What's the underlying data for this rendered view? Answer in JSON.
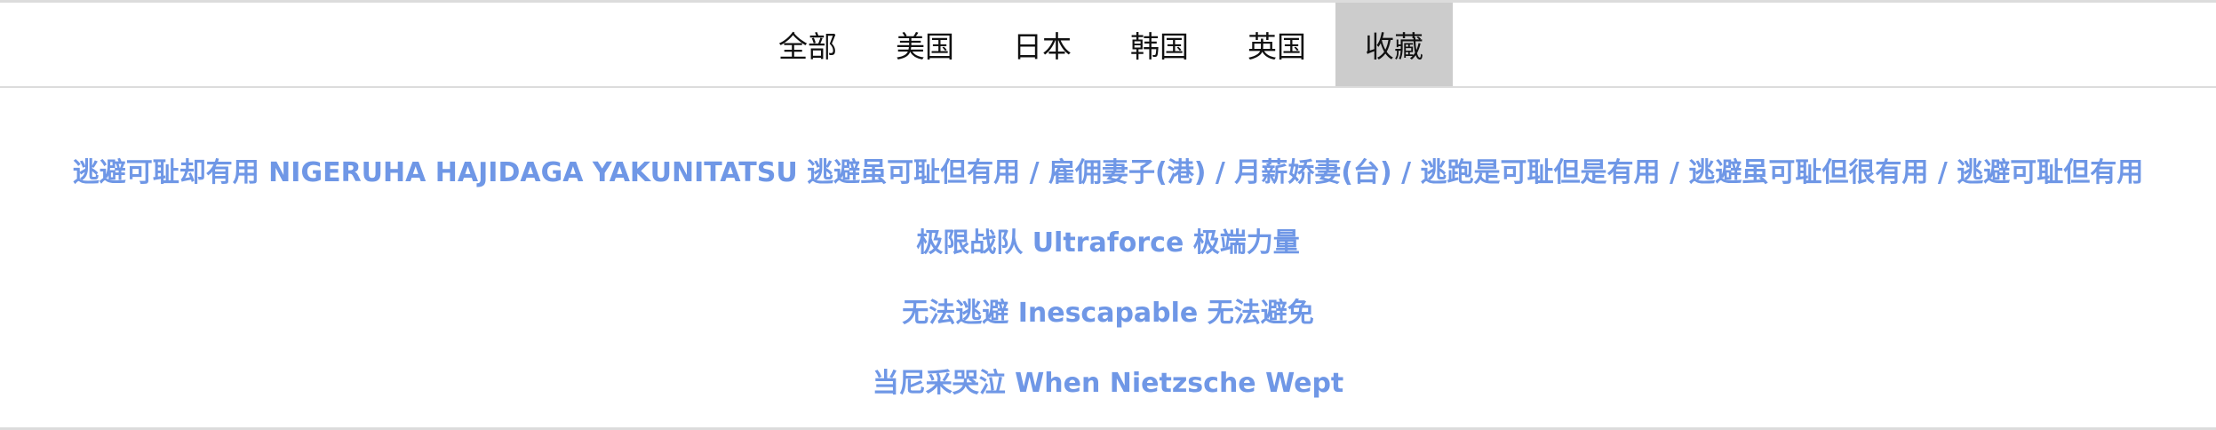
{
  "tabs": [
    {
      "label": "全部",
      "active": false
    },
    {
      "label": "美国",
      "active": false
    },
    {
      "label": "日本",
      "active": false
    },
    {
      "label": "韩国",
      "active": false
    },
    {
      "label": "英国",
      "active": false
    },
    {
      "label": "收藏",
      "active": true
    }
  ],
  "favorites": [
    {
      "title": "逃避可耻却有用 NIGERUHA HAJIDAGA YAKUNITATSU 逃避虽可耻但有用 / 雇佣妻子(港) / 月薪娇妻(台) / 逃跑是可耻但是有用 / 逃避虽可耻但很有用 / 逃避可耻但有用"
    },
    {
      "title": "极限战队 Ultraforce 极端力量"
    },
    {
      "title": "无法逃避 Inescapable 无法避免"
    },
    {
      "title": "当尼采哭泣 When Nietzsche Wept"
    }
  ],
  "colors": {
    "link": "#6f97e6",
    "active_tab_bg": "#cccccc",
    "divider": "#dcdcdc"
  }
}
